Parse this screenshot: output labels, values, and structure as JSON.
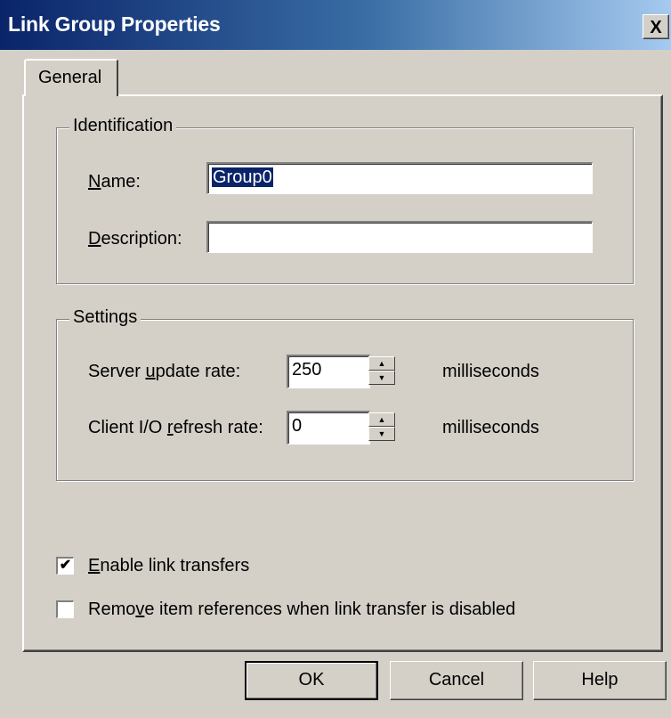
{
  "window": {
    "title": "Link Group Properties",
    "close_label": "X"
  },
  "tabs": [
    {
      "label": "General",
      "selected": true
    }
  ],
  "identification": {
    "group_label": "Identification",
    "name_label": "Name:",
    "name_value": "Group0",
    "description_label": "Description:",
    "description_value": ""
  },
  "settings": {
    "group_label": "Settings",
    "server_update_label": "Server update rate:",
    "server_update_value": "250",
    "server_update_unit": "milliseconds",
    "client_refresh_label": "Client I/O refresh rate:",
    "client_refresh_value": "0",
    "client_refresh_unit": "milliseconds"
  },
  "options": {
    "enable_link_transfers": {
      "label": "Enable link transfers",
      "checked": true
    },
    "remove_item_references": {
      "label": "Remove item references when link transfer is disabled",
      "checked": false
    }
  },
  "buttons": {
    "ok": "OK",
    "cancel": "Cancel",
    "help": "Help"
  }
}
